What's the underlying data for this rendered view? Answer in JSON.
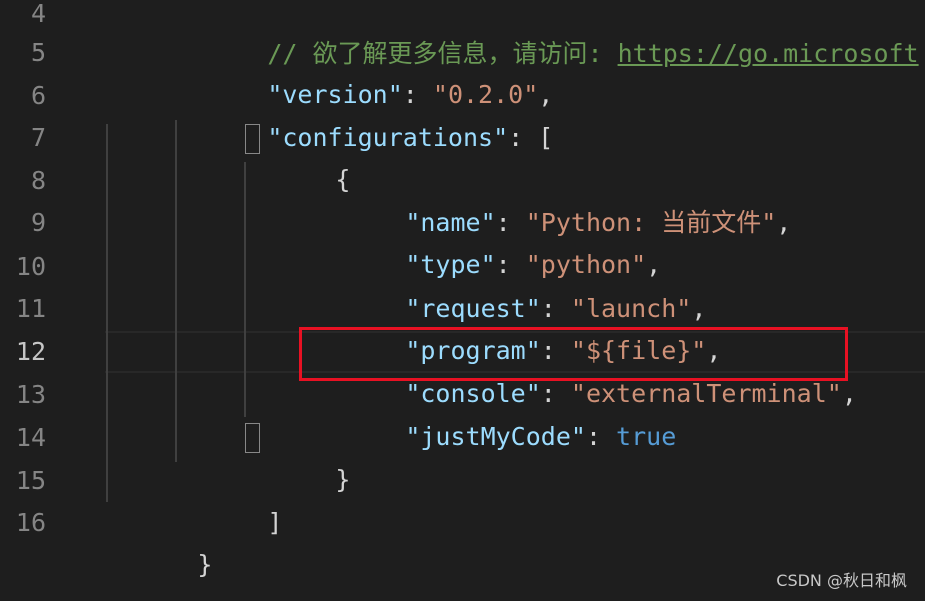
{
  "editor": {
    "line_numbers": [
      "4",
      "5",
      "6",
      "7",
      "8",
      "9",
      "10",
      "11",
      "12",
      "13",
      "14",
      "15",
      "16"
    ],
    "active_line": "12",
    "lines": {
      "l4_comment": "// 欲了解更多信息，请访问: ",
      "l4_url": "https://go.microsoft",
      "l5_key": "\"version\"",
      "l5_sep": ": ",
      "l5_value": "\"0.2.0\"",
      "l5_end": ",",
      "l6_key": "\"configurations\"",
      "l6_sep": ": ",
      "l6_open": "[",
      "l7_open": "{",
      "l8_key": "\"name\"",
      "l8_sep": ": ",
      "l8_value": "\"Python: 当前文件\"",
      "l8_end": ",",
      "l9_key": "\"type\"",
      "l9_sep": ": ",
      "l9_value": "\"python\"",
      "l9_end": ",",
      "l10_key": "\"request\"",
      "l10_sep": ": ",
      "l10_value": "\"launch\"",
      "l10_end": ",",
      "l11_key": "\"program\"",
      "l11_sep": ": ",
      "l11_value": "\"${file}\"",
      "l11_end": ",",
      "l12_key": "\"console\"",
      "l12_sep": ": ",
      "l12_value": "\"externalTerminal\"",
      "l12_end": ",",
      "l13_key": "\"justMyCode\"",
      "l13_sep": ": ",
      "l13_value": "true",
      "l14_close": "}",
      "l15_close": "]",
      "l16_close": "}"
    }
  },
  "watermark": "CSDN @秋日和枫",
  "colors": {
    "background": "#1e1e1e",
    "key": "#9cdcfe",
    "string": "#ce9178",
    "keyword": "#569cd6",
    "comment": "#6a9955",
    "highlight_box": "#e81123"
  }
}
